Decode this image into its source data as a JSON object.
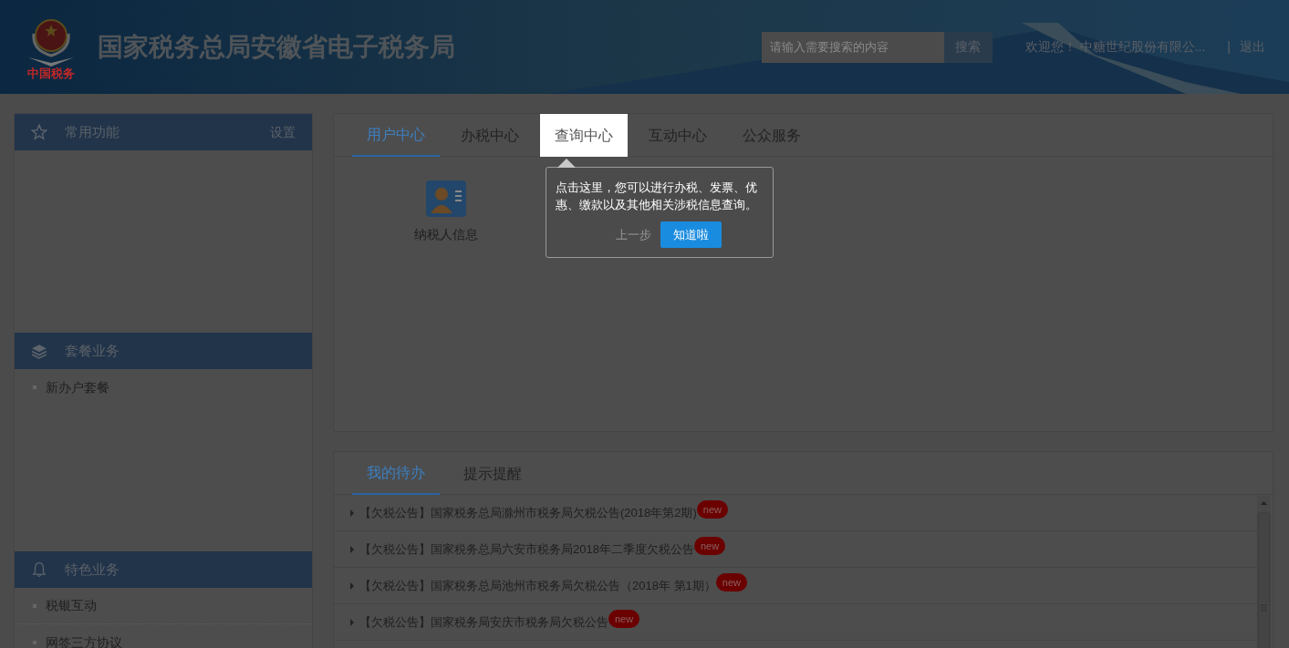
{
  "header": {
    "title": "国家税务总局安徽省电子税务局",
    "logo_caption": "中国税务",
    "search": {
      "placeholder": "请输入需要搜索的内容",
      "button": "搜索"
    },
    "welcome": "欢迎您！ 中糖世纪股份有限公...",
    "separator": "|",
    "logout": "退出"
  },
  "sidebar": {
    "sections": [
      {
        "kind": "star",
        "title": "常用功能",
        "action": "设置"
      },
      {
        "kind": "layers",
        "title": "套餐业务",
        "items": [
          "新办户套餐"
        ]
      },
      {
        "kind": "bell",
        "title": "特色业务",
        "items": [
          "税银互动",
          "网签三方协议"
        ]
      }
    ]
  },
  "main_tabs": [
    {
      "label": "用户中心",
      "selected": true,
      "spotlight": false
    },
    {
      "label": "办税中心",
      "selected": false,
      "spotlight": false
    },
    {
      "label": "查询中心",
      "selected": false,
      "spotlight": true
    },
    {
      "label": "互动中心",
      "selected": false,
      "spotlight": false
    },
    {
      "label": "公众服务",
      "selected": false,
      "spotlight": false
    }
  ],
  "apps": [
    {
      "kind": "person",
      "label": "纳税人信息"
    }
  ],
  "tour_tip": {
    "text": "点击这里，您可以进行办税、发票、优惠、缴款以及其他相关涉税信息查询。",
    "back": "上一步",
    "ok": "知道啦"
  },
  "todo_tabs": [
    {
      "label": "我的待办",
      "selected": true
    },
    {
      "label": "提示提醒",
      "selected": false
    }
  ],
  "todo_items": [
    {
      "text": "【欠税公告】国家税务总局滁州市税务局欠税公告(2018年第2期)",
      "badge": "new"
    },
    {
      "text": "【欠税公告】国家税务总局六安市税务局2018年二季度欠税公告",
      "badge": "new"
    },
    {
      "text": "【欠税公告】国家税务总局池州市税务局欠税公告（2018年 第1期）",
      "badge": "new"
    },
    {
      "text": "【欠税公告】国家税务局安庆市税务局欠税公告",
      "badge": "new"
    }
  ]
}
